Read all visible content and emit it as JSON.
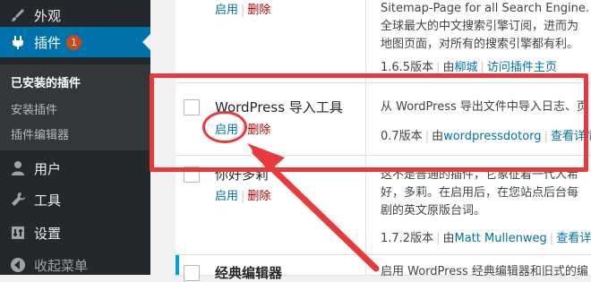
{
  "sidebar": {
    "items": [
      {
        "label": "外观",
        "icon": "brush-icon"
      },
      {
        "label": "插件",
        "icon": "plugin-icon",
        "badge": "1"
      },
      {
        "label": "用户",
        "icon": "user-icon"
      },
      {
        "label": "工具",
        "icon": "wrench-icon"
      },
      {
        "label": "设置",
        "icon": "settings-icon"
      },
      {
        "label": "收起菜单",
        "icon": "collapse-icon"
      }
    ],
    "submenu": [
      "已安装的插件",
      "安装插件",
      "插件编辑器"
    ]
  },
  "plugins": [
    {
      "actions": {
        "activate": "启用",
        "delete": "删除"
      },
      "desc_lines": [
        "Sitemap-Page for all Search Engine. 生",
        "全球最大的中文搜索引擎订阅，进而为",
        "地图页面，对所有的搜索引擎都有利。"
      ],
      "version": "1.6.5版本",
      "by": "由",
      "author": "柳城",
      "visit": "访问插件主页"
    },
    {
      "name": "WordPress 导入工具",
      "actions": {
        "activate": "启用",
        "delete": "删除"
      },
      "desc_lines": [
        "从 WordPress 导出文件中导入日志、页"
      ],
      "version": "0.7版本",
      "by": "由",
      "author": "wordpressdotorg",
      "visit": "查看详情"
    },
    {
      "name": "你好多莉",
      "actions": {
        "activate": "启用",
        "delete": "删除"
      },
      "desc_lines": [
        "这不是普通的插件，它象征着一代人希",
        "好，多莉。在启用后，在您站点后台每",
        "剧的英文原版台词。"
      ],
      "version": "1.7.2版本",
      "by": "由",
      "author": "Matt Mullenweg",
      "visit": "查看详情"
    },
    {
      "name": "经典编辑器",
      "desc_lines": [
        "启用 WordPress 经典编辑器和旧式的编"
      ]
    }
  ],
  "colors": {
    "accent": "#0073aa",
    "annotation": "#e83a3a",
    "sidebar": "#23282d"
  }
}
